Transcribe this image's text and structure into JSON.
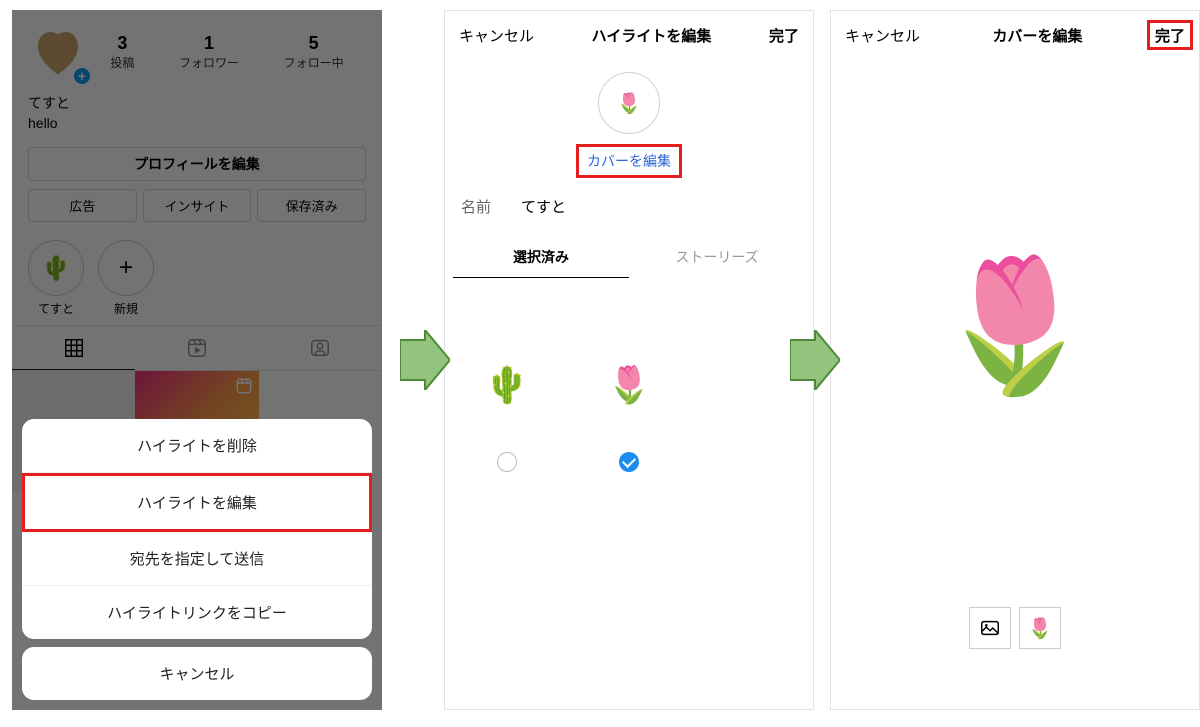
{
  "phone1": {
    "stats": {
      "posts_num": "3",
      "posts_lbl": "投稿",
      "followers_num": "1",
      "followers_lbl": "フォロワー",
      "following_num": "5",
      "following_lbl": "フォロー中"
    },
    "bio_name": "てすと",
    "bio_text": "hello",
    "edit_profile": "プロフィールを編集",
    "btn_ads": "広告",
    "btn_insights": "インサイト",
    "btn_saved": "保存済み",
    "hl1_label": "てすと",
    "hl2_label": "新規",
    "sheet": {
      "delete": "ハイライトを削除",
      "edit": "ハイライトを編集",
      "send_to": "宛先を指定して送信",
      "copy_link": "ハイライトリンクをコピー",
      "cancel": "キャンセル"
    }
  },
  "phone2": {
    "cancel": "キャンセル",
    "title": "ハイライトを編集",
    "done": "完了",
    "edit_cover": "カバーを編集",
    "name_label": "名前",
    "name_value": "てすと",
    "tab_selected": "選択済み",
    "tab_stories": "ストーリーズ",
    "emoji_cactus": "🌵",
    "emoji_tulip": "🌷"
  },
  "phone3": {
    "cancel": "キャンセル",
    "title": "カバーを編集",
    "done": "完了",
    "emoji_tulip": "🌷"
  }
}
